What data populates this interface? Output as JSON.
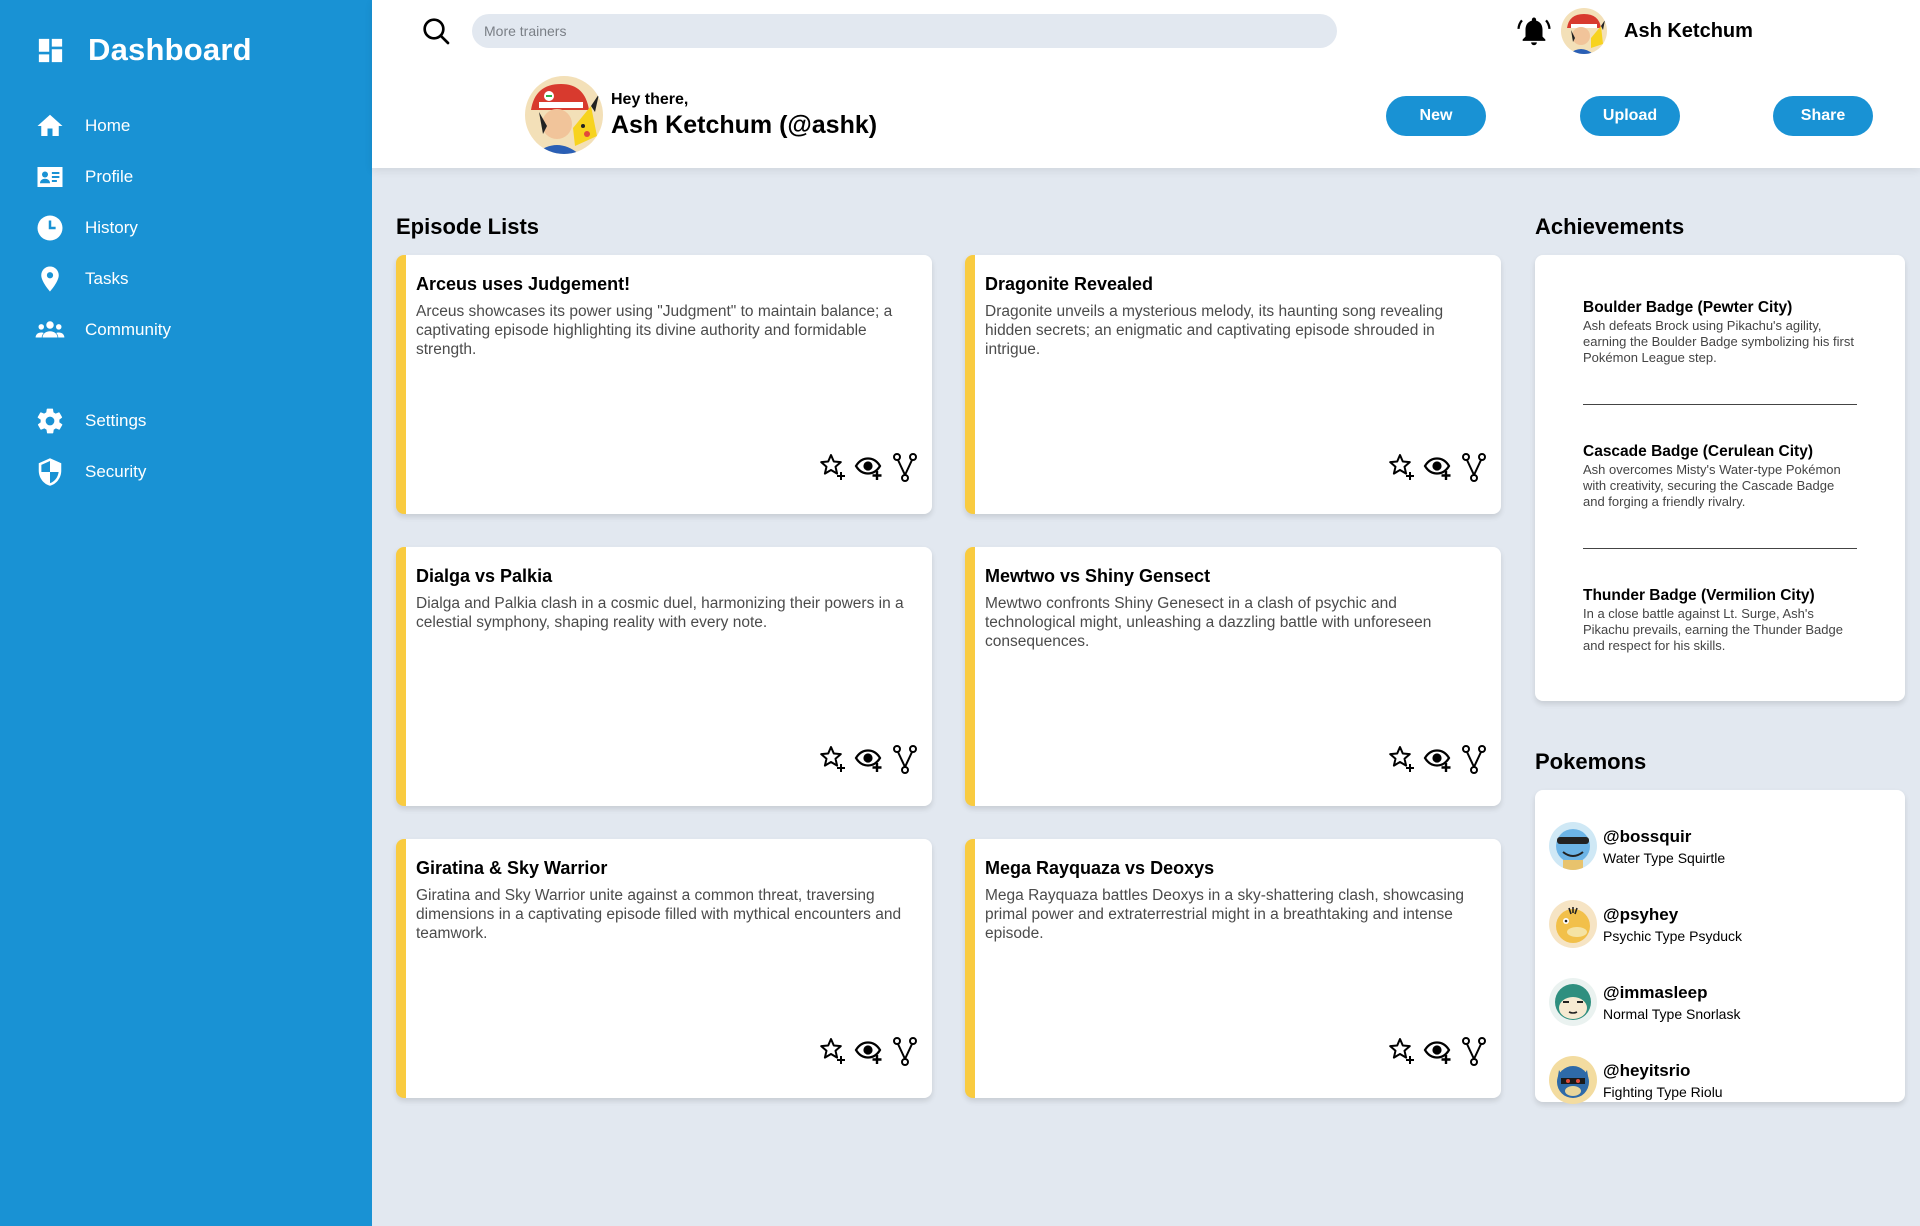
{
  "sidebar": {
    "title": "Dashboard",
    "items": [
      {
        "label": "Home",
        "icon": "home-icon"
      },
      {
        "label": "Profile",
        "icon": "id-card-icon"
      },
      {
        "label": "History",
        "icon": "clock-icon"
      },
      {
        "label": "Tasks",
        "icon": "map-pin-icon"
      },
      {
        "label": "Community",
        "icon": "users-icon"
      },
      {
        "label": "Settings",
        "icon": "gear-icon"
      },
      {
        "label": "Security",
        "icon": "shield-icon"
      }
    ]
  },
  "header": {
    "search_placeholder": "More trainers",
    "user_name": "Ash Ketchum",
    "greeting_small": "Hey there,",
    "greeting_big": "Ash Ketchum (@ashk)",
    "buttons": {
      "new": "New",
      "upload": "Upload",
      "share": "Share"
    }
  },
  "episodes": {
    "title": "Episode Lists",
    "items": [
      {
        "title": "Arceus uses Judgement!",
        "desc": "Arceus showcases its power using \"Judgment\" to maintain balance; a captivating episode highlighting its divine authority and formidable strength."
      },
      {
        "title": "Dragonite Revealed",
        "desc": "Dragonite unveils a mysterious melody, its haunting song revealing hidden secrets; an enigmatic and captivating episode shrouded in intrigue."
      },
      {
        "title": "Dialga vs Palkia",
        "desc": "Dialga and Palkia clash in a cosmic duel, harmonizing their powers in a celestial symphony, shaping reality with every note."
      },
      {
        "title": "Mewtwo vs Shiny Gensect",
        "desc": "Mewtwo confronts Shiny Genesect in a clash of psychic and technological might, unleashing a dazzling battle with unforeseen consequences."
      },
      {
        "title": "Giratina & Sky Warrior",
        "desc": "Giratina and Sky Warrior unite against a common threat, traversing dimensions in a captivating episode filled with mythical encounters and teamwork."
      },
      {
        "title": "Mega Rayquaza vs Deoxys",
        "desc": "Mega Rayquaza battles Deoxys in a sky-shattering clash, showcasing primal power and extraterrestrial might in a breathtaking and intense episode."
      }
    ]
  },
  "achievements": {
    "title": "Achievements",
    "items": [
      {
        "title": "Boulder Badge (Pewter City)",
        "desc": "Ash defeats Brock using Pikachu's agility, earning the Boulder Badge symbolizing his first Pokémon League step."
      },
      {
        "title": "Cascade Badge (Cerulean City)",
        "desc": "Ash overcomes Misty's Water-type Pokémon with creativity, securing the Cascade Badge and forging a friendly rivalry."
      },
      {
        "title": "Thunder Badge (Vermilion City)",
        "desc": "In a close battle against Lt. Surge, Ash's Pikachu prevails, earning the Thunder Badge and respect for his skills."
      }
    ]
  },
  "pokemons": {
    "title": "Pokemons",
    "items": [
      {
        "handle": "@bossquir",
        "type": "Water Type Squirtle"
      },
      {
        "handle": "@psyhey",
        "type": "Psychic Type Psyduck"
      },
      {
        "handle": "@immasleep",
        "type": "Normal Type Snorlask"
      },
      {
        "handle": "@heyitsrio",
        "type": "Fighting Type Riolu"
      }
    ]
  },
  "colors": {
    "primary": "#1992d4",
    "accent": "#f9cb40",
    "background": "#e2e8f0"
  }
}
